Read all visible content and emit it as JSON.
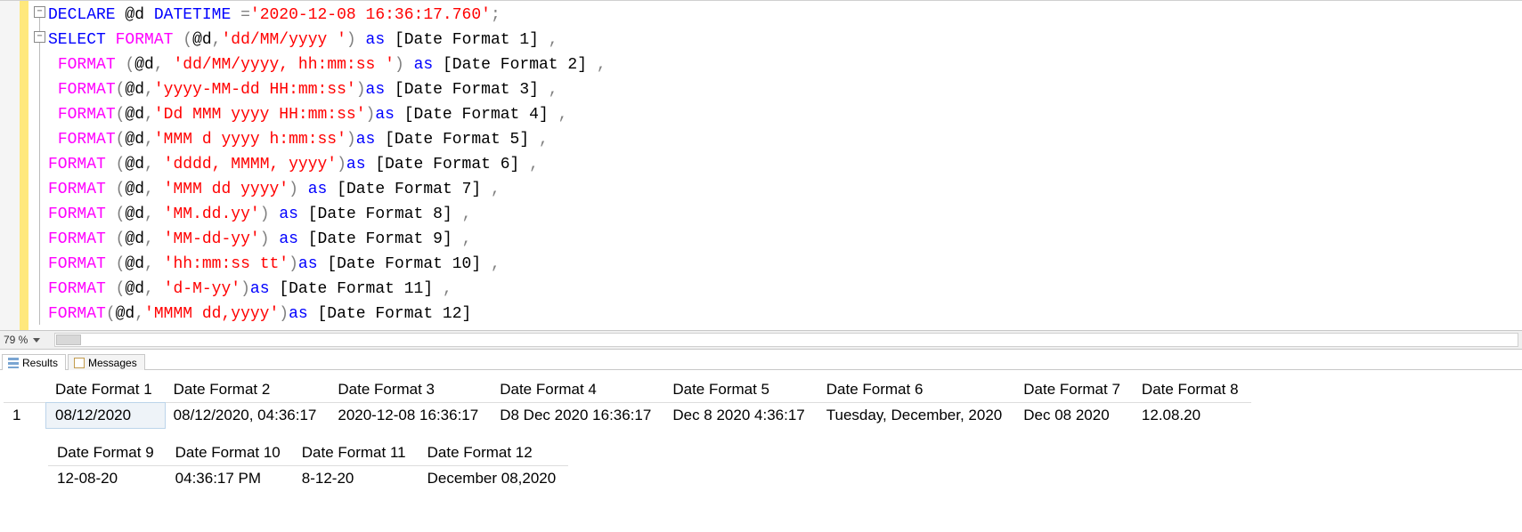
{
  "zoom": {
    "value": "79 %"
  },
  "tabs": {
    "results": "Results",
    "messages": "Messages"
  },
  "code": {
    "rows": [
      [
        {
          "cls": "kw",
          "t": "DECLARE"
        },
        {
          "cls": "plain",
          "t": " @d "
        },
        {
          "cls": "ty",
          "t": "DATETIME"
        },
        {
          "cls": "plain",
          "t": " "
        },
        {
          "cls": "op",
          "t": "="
        },
        {
          "cls": "str",
          "t": "'2020-12-08 16:36:17.760'"
        },
        {
          "cls": "op",
          "t": ";"
        }
      ],
      [
        {
          "cls": "kw",
          "t": "SELECT"
        },
        {
          "cls": "plain",
          "t": " "
        },
        {
          "cls": "fn",
          "t": "FORMAT"
        },
        {
          "cls": "plain",
          "t": " "
        },
        {
          "cls": "op",
          "t": "("
        },
        {
          "cls": "plain",
          "t": "@d"
        },
        {
          "cls": "op",
          "t": ","
        },
        {
          "cls": "str",
          "t": "'dd/MM/yyyy '"
        },
        {
          "cls": "op",
          "t": ")"
        },
        {
          "cls": "plain",
          "t": " "
        },
        {
          "cls": "ali",
          "t": "as"
        },
        {
          "cls": "plain",
          "t": " [Date Format 1] "
        },
        {
          "cls": "op",
          "t": ","
        }
      ],
      [
        {
          "cls": "plain",
          "t": " "
        },
        {
          "cls": "fn",
          "t": "FORMAT"
        },
        {
          "cls": "plain",
          "t": " "
        },
        {
          "cls": "op",
          "t": "("
        },
        {
          "cls": "plain",
          "t": "@d"
        },
        {
          "cls": "op",
          "t": ","
        },
        {
          "cls": "plain",
          "t": " "
        },
        {
          "cls": "str",
          "t": "'dd/MM/yyyy, hh:mm:ss '"
        },
        {
          "cls": "op",
          "t": ")"
        },
        {
          "cls": "plain",
          "t": " "
        },
        {
          "cls": "ali",
          "t": "as"
        },
        {
          "cls": "plain",
          "t": " [Date Format 2] "
        },
        {
          "cls": "op",
          "t": ","
        }
      ],
      [
        {
          "cls": "plain",
          "t": " "
        },
        {
          "cls": "fn",
          "t": "FORMAT"
        },
        {
          "cls": "op",
          "t": "("
        },
        {
          "cls": "plain",
          "t": "@d"
        },
        {
          "cls": "op",
          "t": ","
        },
        {
          "cls": "str",
          "t": "'yyyy-MM-dd HH:mm:ss'"
        },
        {
          "cls": "op",
          "t": ")"
        },
        {
          "cls": "ali",
          "t": "as"
        },
        {
          "cls": "plain",
          "t": " [Date Format 3] "
        },
        {
          "cls": "op",
          "t": ","
        }
      ],
      [
        {
          "cls": "plain",
          "t": " "
        },
        {
          "cls": "fn",
          "t": "FORMAT"
        },
        {
          "cls": "op",
          "t": "("
        },
        {
          "cls": "plain",
          "t": "@d"
        },
        {
          "cls": "op",
          "t": ","
        },
        {
          "cls": "str",
          "t": "'Dd MMM yyyy HH:mm:ss'"
        },
        {
          "cls": "op",
          "t": ")"
        },
        {
          "cls": "ali",
          "t": "as"
        },
        {
          "cls": "plain",
          "t": " [Date Format 4] "
        },
        {
          "cls": "op",
          "t": ","
        }
      ],
      [
        {
          "cls": "plain",
          "t": " "
        },
        {
          "cls": "fn",
          "t": "FORMAT"
        },
        {
          "cls": "op",
          "t": "("
        },
        {
          "cls": "plain",
          "t": "@d"
        },
        {
          "cls": "op",
          "t": ","
        },
        {
          "cls": "str",
          "t": "'MMM d yyyy h:mm:ss'"
        },
        {
          "cls": "op",
          "t": ")"
        },
        {
          "cls": "ali",
          "t": "as"
        },
        {
          "cls": "plain",
          "t": " [Date Format 5] "
        },
        {
          "cls": "op",
          "t": ","
        }
      ],
      [
        {
          "cls": "fn",
          "t": "FORMAT"
        },
        {
          "cls": "plain",
          "t": " "
        },
        {
          "cls": "op",
          "t": "("
        },
        {
          "cls": "plain",
          "t": "@d"
        },
        {
          "cls": "op",
          "t": ","
        },
        {
          "cls": "plain",
          "t": " "
        },
        {
          "cls": "str",
          "t": "'dddd, MMMM, yyyy'"
        },
        {
          "cls": "op",
          "t": ")"
        },
        {
          "cls": "ali",
          "t": "as"
        },
        {
          "cls": "plain",
          "t": " [Date Format 6] "
        },
        {
          "cls": "op",
          "t": ","
        }
      ],
      [
        {
          "cls": "fn",
          "t": "FORMAT"
        },
        {
          "cls": "plain",
          "t": " "
        },
        {
          "cls": "op",
          "t": "("
        },
        {
          "cls": "plain",
          "t": "@d"
        },
        {
          "cls": "op",
          "t": ","
        },
        {
          "cls": "plain",
          "t": " "
        },
        {
          "cls": "str",
          "t": "'MMM dd yyyy'"
        },
        {
          "cls": "op",
          "t": ")"
        },
        {
          "cls": "plain",
          "t": " "
        },
        {
          "cls": "ali",
          "t": "as"
        },
        {
          "cls": "plain",
          "t": " [Date Format 7] "
        },
        {
          "cls": "op",
          "t": ","
        }
      ],
      [
        {
          "cls": "fn",
          "t": "FORMAT"
        },
        {
          "cls": "plain",
          "t": " "
        },
        {
          "cls": "op",
          "t": "("
        },
        {
          "cls": "plain",
          "t": "@d"
        },
        {
          "cls": "op",
          "t": ","
        },
        {
          "cls": "plain",
          "t": " "
        },
        {
          "cls": "str",
          "t": "'MM.dd.yy'"
        },
        {
          "cls": "op",
          "t": ")"
        },
        {
          "cls": "plain",
          "t": " "
        },
        {
          "cls": "ali",
          "t": "as"
        },
        {
          "cls": "plain",
          "t": " [Date Format 8] "
        },
        {
          "cls": "op",
          "t": ","
        }
      ],
      [
        {
          "cls": "fn",
          "t": "FORMAT"
        },
        {
          "cls": "plain",
          "t": " "
        },
        {
          "cls": "op",
          "t": "("
        },
        {
          "cls": "plain",
          "t": "@d"
        },
        {
          "cls": "op",
          "t": ","
        },
        {
          "cls": "plain",
          "t": " "
        },
        {
          "cls": "str",
          "t": "'MM-dd-yy'"
        },
        {
          "cls": "op",
          "t": ")"
        },
        {
          "cls": "plain",
          "t": " "
        },
        {
          "cls": "ali",
          "t": "as"
        },
        {
          "cls": "plain",
          "t": " [Date Format 9] "
        },
        {
          "cls": "op",
          "t": ","
        }
      ],
      [
        {
          "cls": "fn",
          "t": "FORMAT"
        },
        {
          "cls": "plain",
          "t": " "
        },
        {
          "cls": "op",
          "t": "("
        },
        {
          "cls": "plain",
          "t": "@d"
        },
        {
          "cls": "op",
          "t": ","
        },
        {
          "cls": "plain",
          "t": " "
        },
        {
          "cls": "str",
          "t": "'hh:mm:ss tt'"
        },
        {
          "cls": "op",
          "t": ")"
        },
        {
          "cls": "ali",
          "t": "as"
        },
        {
          "cls": "plain",
          "t": " [Date Format 10] "
        },
        {
          "cls": "op",
          "t": ","
        }
      ],
      [
        {
          "cls": "fn",
          "t": "FORMAT"
        },
        {
          "cls": "plain",
          "t": " "
        },
        {
          "cls": "op",
          "t": "("
        },
        {
          "cls": "plain",
          "t": "@d"
        },
        {
          "cls": "op",
          "t": ","
        },
        {
          "cls": "plain",
          "t": " "
        },
        {
          "cls": "str",
          "t": "'d-M-yy'"
        },
        {
          "cls": "op",
          "t": ")"
        },
        {
          "cls": "ali",
          "t": "as"
        },
        {
          "cls": "plain",
          "t": " [Date Format 11] "
        },
        {
          "cls": "op",
          "t": ","
        }
      ],
      [
        {
          "cls": "fn",
          "t": "FORMAT"
        },
        {
          "cls": "op",
          "t": "("
        },
        {
          "cls": "plain",
          "t": "@d"
        },
        {
          "cls": "op",
          "t": ","
        },
        {
          "cls": "str",
          "t": "'MMMM dd,yyyy'"
        },
        {
          "cls": "op",
          "t": ")"
        },
        {
          "cls": "ali",
          "t": "as"
        },
        {
          "cls": "plain",
          "t": " [Date Format 12]"
        }
      ]
    ]
  },
  "results1": {
    "rownum": "1",
    "headers": [
      "Date Format 1",
      "Date Format 2",
      "Date Format 3",
      "Date Format 4",
      "Date Format 5",
      "Date Format 6",
      "Date Format 7",
      "Date Format 8"
    ],
    "cells": [
      "08/12/2020",
      "08/12/2020, 04:36:17",
      "2020-12-08 16:36:17",
      "D8 Dec 2020 16:36:17",
      "Dec 8 2020 4:36:17",
      "Tuesday, December, 2020",
      "Dec 08 2020",
      "12.08.20"
    ]
  },
  "results2": {
    "headers": [
      "Date Format 9",
      "Date Format 10",
      "Date Format 11",
      "Date Format 12"
    ],
    "cells": [
      "12-08-20",
      "04:36:17 PM",
      "8-12-20",
      "December 08,2020"
    ]
  }
}
